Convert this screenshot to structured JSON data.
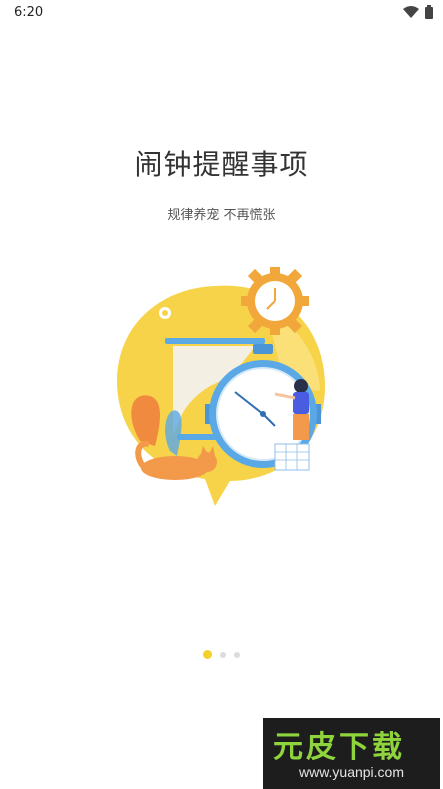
{
  "status_bar": {
    "time": "6:20"
  },
  "onboarding": {
    "title": "闹钟提醒事项",
    "subtitle": "规律养宠 不再慌张",
    "pager": {
      "pages": 3,
      "active": 1
    }
  },
  "watermark": {
    "brand": "元皮下载",
    "url": "www.yuanpi.com"
  },
  "colors": {
    "accent_yellow": "#f5cf2a",
    "clock_blue": "#5aa9e6",
    "orange": "#f29a4a",
    "background": "#ffffff"
  },
  "icons": [
    "wifi-icon",
    "battery-icon",
    "clock-illustration",
    "gear-clock-icon",
    "hourglass-icon",
    "cat-illustration",
    "person-illustration"
  ]
}
